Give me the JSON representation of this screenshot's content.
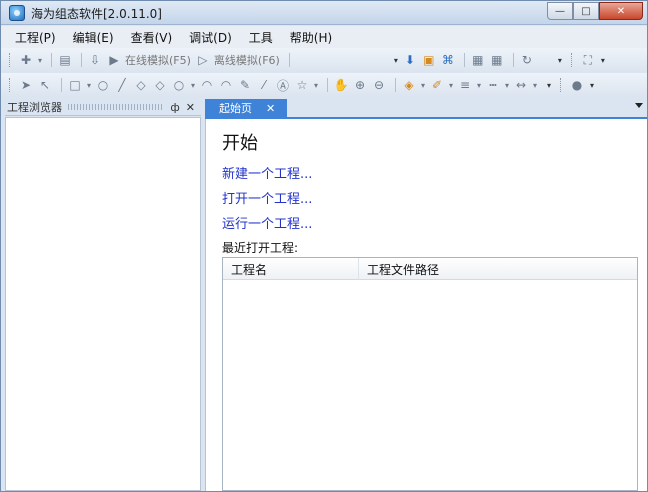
{
  "window": {
    "title": "海为组态软件[2.0.11.0]",
    "controls": {
      "minimize": "—",
      "maximize": "□",
      "close": "✕"
    }
  },
  "menubar": {
    "items": [
      {
        "label": "工程(P)"
      },
      {
        "label": "编辑(E)"
      },
      {
        "label": "查看(V)"
      },
      {
        "label": "调试(D)"
      },
      {
        "label": "工具"
      },
      {
        "label": "帮助(H)"
      }
    ]
  },
  "toolbar": {
    "online_sim": "在线模拟(F5)",
    "offline_sim": "离线模拟(F6)"
  },
  "left_panel": {
    "title": "工程浏览器",
    "pin": "ф",
    "close": "✕"
  },
  "tabs": [
    {
      "label": "起始页",
      "close": "✕"
    }
  ],
  "start_page": {
    "heading": "开始",
    "links": [
      {
        "label": "新建一个工程..."
      },
      {
        "label": "打开一个工程..."
      },
      {
        "label": "运行一个工程..."
      }
    ],
    "recent_label": "最近打开工程:",
    "recent_columns": [
      "工程名",
      "工程文件路径"
    ]
  },
  "colors": {
    "accent": "#3f83d9",
    "link": "#2233cc"
  }
}
